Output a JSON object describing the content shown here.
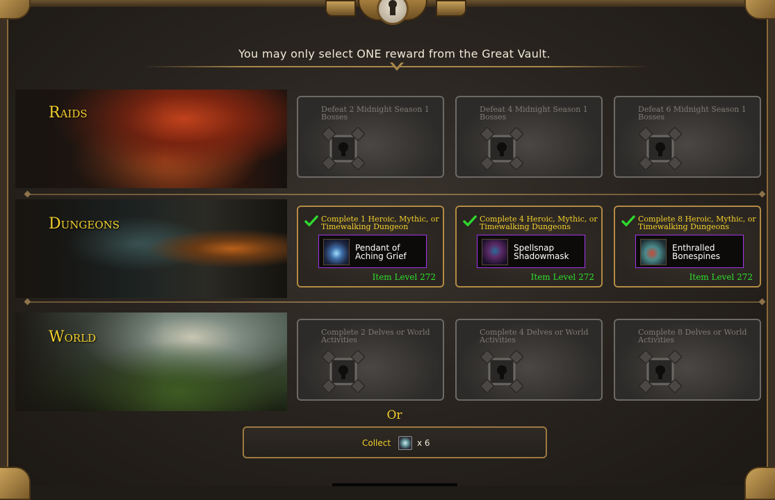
{
  "header": {
    "message": "You may only select ONE reward from the Great Vault."
  },
  "rows": [
    {
      "label": "Raids",
      "slots": [
        {
          "title": "Defeat 2 Midnight Season 1 Bosses",
          "state": "locked"
        },
        {
          "title": "Defeat 4 Midnight Season 1 Bosses",
          "state": "locked"
        },
        {
          "title": "Defeat 6 Midnight Season 1 Bosses",
          "state": "locked"
        }
      ]
    },
    {
      "label": "Dungeons",
      "slots": [
        {
          "title": "Complete 1 Heroic, Mythic, or Timewalking Dungeon",
          "state": "unlocked",
          "reward": {
            "name": "Pendant of Aching Grief",
            "icon": "pendant-icon"
          },
          "item_level": "Item Level 272"
        },
        {
          "title": "Complete 4 Heroic, Mythic, or Timewalking Dungeons",
          "state": "unlocked",
          "reward": {
            "name": "Spellsnap Shadowmask",
            "icon": "mask-icon"
          },
          "item_level": "Item Level 272"
        },
        {
          "title": "Complete 8 Heroic, Mythic, or Timewalking Dungeons",
          "state": "unlocked",
          "reward": {
            "name": "Enthralled Bonespines",
            "icon": "bonespines-icon"
          },
          "item_level": "Item Level 272"
        }
      ]
    },
    {
      "label": "World",
      "slots": [
        {
          "title": "Complete 2 Delves or World Activities",
          "state": "locked"
        },
        {
          "title": "Complete 4 Delves or World Activities",
          "state": "locked"
        },
        {
          "title": "Complete 8 Delves or World Activities",
          "state": "locked"
        }
      ]
    }
  ],
  "alternative": {
    "or_label": "Or",
    "collect_label": "Collect",
    "collect_count": "x 6",
    "currency_icon": "currency-icon"
  },
  "colors": {
    "gold_text": "#f3cf2d",
    "item_level_green": "#2ee02e",
    "epic_border": "#a335ee",
    "check_green": "#2ed82e"
  }
}
